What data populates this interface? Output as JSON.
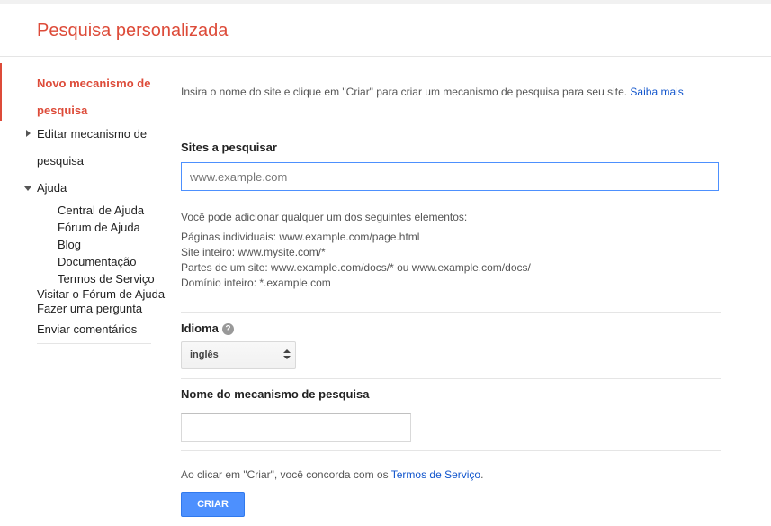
{
  "header": {
    "title": "Pesquisa personalizada"
  },
  "sidebar": {
    "new_engine": "Novo mecanismo de pesquisa",
    "edit_engine": "Editar mecanismo de pesquisa",
    "help": "Ajuda",
    "help_items": [
      "Central de Ajuda",
      "Fórum de Ajuda",
      "Blog",
      "Documentação",
      "Termos de Serviço"
    ],
    "visit_forum": "Visitar o Fórum de Ajuda",
    "ask_question": "Fazer uma pergunta",
    "send_feedback": "Enviar comentários"
  },
  "main": {
    "intro": "Insira o nome do site e clique em \"Criar\" para criar um mecanismo de pesquisa para seu site.",
    "learn_more": "Saiba mais",
    "sites_label": "Sites a pesquisar",
    "sites_placeholder": "www.example.com",
    "add_hint": "Você pode adicionar qualquer um dos seguintes elementos:",
    "examples": [
      "Páginas individuais: www.example.com/page.html",
      "Site inteiro: www.mysite.com/*",
      "Partes de um site: www.example.com/docs/* ou www.example.com/docs/",
      "Domínio inteiro: *.example.com"
    ],
    "language_label": "Idioma",
    "help_icon": "?",
    "language_value": "inglês",
    "name_label": "Nome do mecanismo de pesquisa",
    "name_value": "",
    "agree_prefix": "Ao clicar em \"Criar\", você concorda com os",
    "tos_link": "Termos de Serviço",
    "agree_suffix": ".",
    "create_button": "CRIAR"
  },
  "colors": {
    "brand": "#dd4b39",
    "link": "#1155cc",
    "button": "#4d90fe"
  },
  "icons": {
    "collapsed": "triangle-right-icon",
    "expanded": "triangle-down-icon",
    "help": "question-circle-icon",
    "select": "up-down-arrows-icon"
  }
}
